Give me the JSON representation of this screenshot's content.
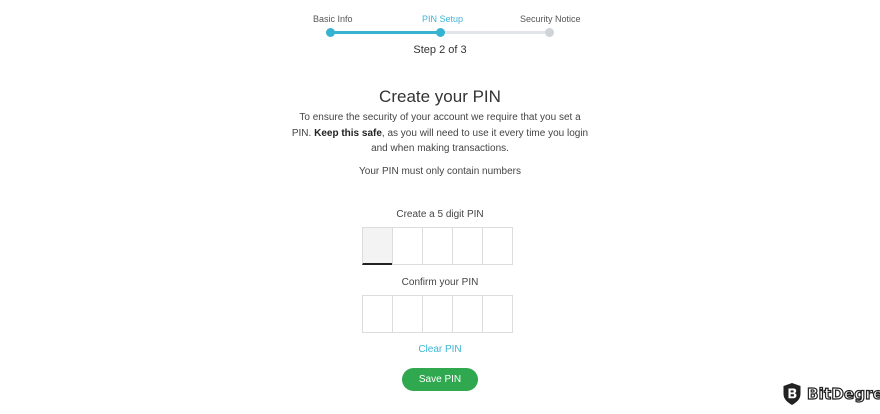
{
  "stepper": {
    "steps": [
      {
        "label": "Basic Info",
        "state": "complete"
      },
      {
        "label": "PIN Setup",
        "state": "active"
      },
      {
        "label": "Security Notice",
        "state": "pending"
      }
    ],
    "counter": "Step 2 of 3",
    "progress_fraction": 0.5,
    "colors": {
      "complete": "#35b3d1",
      "pending": "#cfd4d9",
      "track": "#e2e6ea"
    }
  },
  "content": {
    "title": "Create your PIN",
    "intro_part1": "To ensure the security of your account we require that you set a PIN.",
    "intro_bold": "Keep this safe",
    "intro_part2": ", as you will need to use it every time you login and when making transactions.",
    "rule": "Your PIN must only contain numbers"
  },
  "create_pin": {
    "label": "Create a 5 digit PIN",
    "digits": [
      "",
      "",
      "",
      "",
      ""
    ]
  },
  "confirm_pin": {
    "label": "Confirm your PIN",
    "digits": [
      "",
      "",
      "",
      "",
      ""
    ]
  },
  "actions": {
    "clear_label": "Clear PIN",
    "save_label": "Save PIN",
    "save_color": "#2fa84f",
    "link_color": "#3cb5d6"
  },
  "watermark": {
    "text": "BitDegree",
    "icon": "bitdegree-shield-logo-icon"
  }
}
